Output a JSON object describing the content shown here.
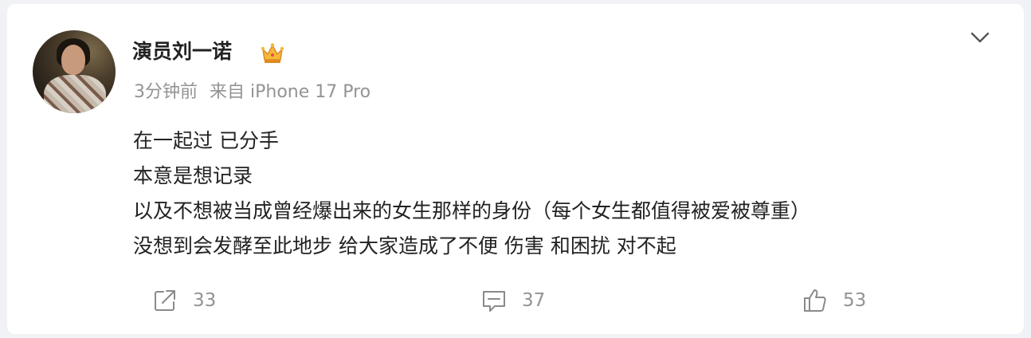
{
  "post": {
    "author": "演员刘一诺",
    "badge_icon": "crown-icon",
    "time": "3分钟前",
    "source": "来自 iPhone 17 Pro",
    "lines": [
      "在一起过 已分手",
      "本意是想记录",
      "以及不想被当成曾经爆出来的女生那样的身份（每个女生都值得被爱被尊重）",
      "没想到会发酵至此地步 给大家造成了不便 伤害 和困扰 对不起"
    ]
  },
  "actions": {
    "share_count": "33",
    "comment_count": "37",
    "like_count": "53"
  },
  "colors": {
    "background": "#f1f2f5",
    "card": "#ffffff",
    "text": "#222222",
    "meta": "#939393",
    "crown": "#f5b93b"
  }
}
